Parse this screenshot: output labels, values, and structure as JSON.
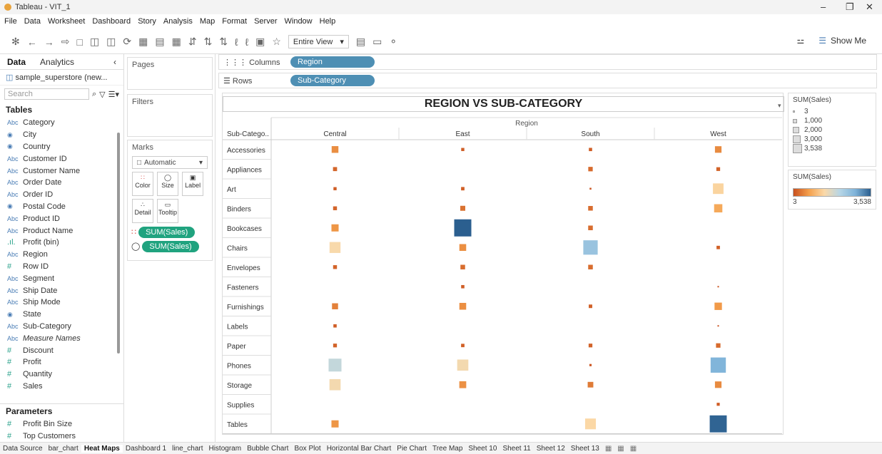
{
  "window": {
    "title": "Tableau - VIT_1"
  },
  "menu": [
    "File",
    "Data",
    "Worksheet",
    "Dashboard",
    "Story",
    "Analysis",
    "Map",
    "Format",
    "Server",
    "Window",
    "Help"
  ],
  "toolbar": {
    "view_select": "Entire View",
    "show_me": "Show Me"
  },
  "data_pane": {
    "tabs": [
      "Data",
      "Analytics"
    ],
    "datasource": "sample_superstore (new...",
    "search_placeholder": "Search",
    "tables_heading": "Tables",
    "fields": [
      {
        "type": "Abc",
        "name": "Category"
      },
      {
        "type": "globe",
        "name": "City"
      },
      {
        "type": "globe",
        "name": "Country"
      },
      {
        "type": "Abc",
        "name": "Customer ID"
      },
      {
        "type": "Abc",
        "name": "Customer Name"
      },
      {
        "type": "Abc",
        "name": "Order Date"
      },
      {
        "type": "Abc",
        "name": "Order ID"
      },
      {
        "type": "globe",
        "name": "Postal Code"
      },
      {
        "type": "Abc",
        "name": "Product ID"
      },
      {
        "type": "Abc",
        "name": "Product Name"
      },
      {
        "type": "bin",
        "name": "Profit (bin)"
      },
      {
        "type": "Abc",
        "name": "Region"
      },
      {
        "type": "#",
        "name": "Row ID"
      },
      {
        "type": "Abc",
        "name": "Segment"
      },
      {
        "type": "Abc",
        "name": "Ship Date"
      },
      {
        "type": "Abc",
        "name": "Ship Mode"
      },
      {
        "type": "globe",
        "name": "State"
      },
      {
        "type": "Abc",
        "name": "Sub-Category"
      },
      {
        "type": "Abc",
        "name": "Measure Names",
        "italic": true
      },
      {
        "type": "#",
        "name": "Discount"
      },
      {
        "type": "#",
        "name": "Profit"
      },
      {
        "type": "#",
        "name": "Quantity"
      },
      {
        "type": "#",
        "name": "Sales"
      }
    ],
    "parameters_heading": "Parameters",
    "parameters": [
      {
        "type": "#",
        "name": "Profit Bin Size"
      },
      {
        "type": "#",
        "name": "Top Customers"
      }
    ]
  },
  "cards": {
    "pages": "Pages",
    "filters": "Filters",
    "marks": "Marks",
    "mark_type": "Automatic",
    "mark_buttons": [
      "Color",
      "Size",
      "Label",
      "Detail",
      "Tooltip"
    ],
    "mark_pills": [
      "SUM(Sales)",
      "SUM(Sales)"
    ]
  },
  "shelves": {
    "columns_label": "Columns",
    "columns_pill": "Region",
    "rows_label": "Rows",
    "rows_pill": "Sub-Category"
  },
  "legends": {
    "size_title": "SUM(Sales)",
    "size_items": [
      "3",
      "1,000",
      "2,000",
      "3,000",
      "3,538"
    ],
    "color_title": "SUM(Sales)",
    "color_min": "3",
    "color_max": "3,538",
    "colors": [
      "#c8501e",
      "#f4a04c",
      "#fbd9a8",
      "#b7d6e6",
      "#7fb3d9",
      "#2b5f8f"
    ]
  },
  "bottom_tabs": [
    "Data Source",
    "bar_chart",
    "Heat Maps",
    "Dashboard 1",
    "line_chart",
    "Histogram",
    "Bubble Chart",
    "Box Plot",
    "Horizontal Bar Chart",
    "Pie Chart",
    "Tree Map",
    "Sheet 10",
    "Sheet 11",
    "Sheet 12",
    "Sheet 13"
  ],
  "chart_data": {
    "type": "heatmap",
    "title": "REGION VS SUB-CATEGORY",
    "column_header": "Region",
    "row_header": "Sub-Catego..",
    "columns": [
      "Central",
      "East",
      "South",
      "West"
    ],
    "rows": [
      "Accessories",
      "Appliances",
      "Art",
      "Binders",
      "Bookcases",
      "Chairs",
      "Envelopes",
      "Fasteners",
      "Furnishings",
      "Labels",
      "Paper",
      "Phones",
      "Storage",
      "Supplies",
      "Tables"
    ],
    "measure": "SUM(Sales)",
    "color_range": [
      3,
      3538
    ],
    "values": [
      [
        550,
        120,
        130,
        520
      ],
      [
        200,
        null,
        240,
        170
      ],
      [
        120,
        140,
        40,
        1350
      ],
      [
        180,
        300,
        260,
        820
      ],
      [
        620,
        3538,
        260,
        null
      ],
      [
        1450,
        560,
        2500,
        140
      ],
      [
        180,
        260,
        260,
        null
      ],
      [
        null,
        130,
        null,
        20
      ],
      [
        440,
        560,
        150,
        660
      ],
      [
        130,
        null,
        null,
        15
      ],
      [
        170,
        140,
        170,
        240
      ],
      [
        2000,
        1500,
        60,
        2800
      ],
      [
        1500,
        580,
        380,
        520
      ],
      [
        null,
        null,
        null,
        110
      ],
      [
        620,
        null,
        1400,
        3500
      ]
    ]
  }
}
